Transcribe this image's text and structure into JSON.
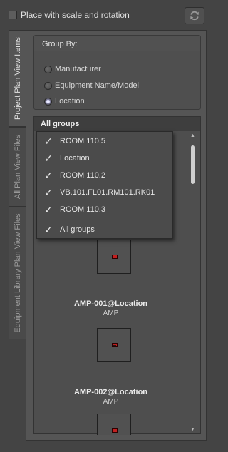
{
  "top": {
    "place_label": "Place with scale and rotation",
    "place_checked": false
  },
  "tabs": [
    {
      "label": "Project Plan View Items",
      "active": true
    },
    {
      "label": "All Plan View Files",
      "active": false
    },
    {
      "label": "Equipment Library Plan View Files",
      "active": false
    }
  ],
  "group_by": {
    "title": "Group By:",
    "options": [
      {
        "label": "Manufacturer",
        "selected": false
      },
      {
        "label": "Equipment Name/Model",
        "selected": false
      },
      {
        "label": "Location",
        "selected": true
      }
    ]
  },
  "list": {
    "header": "All groups",
    "items": [
      {
        "name": "AMP-001@Location",
        "type": "AMP"
      },
      {
        "name": "AMP-002@Location",
        "type": "AMP"
      },
      {
        "name": "",
        "type": ""
      }
    ]
  },
  "dropdown": {
    "items": [
      {
        "label": "ROOM 110.5",
        "checked": true
      },
      {
        "label": "Location",
        "checked": true
      },
      {
        "label": "ROOM 110.2",
        "checked": true
      },
      {
        "label": "VB.101.FL01.RM101.RK01",
        "checked": true
      },
      {
        "label": "ROOM 110.3",
        "checked": true
      },
      {
        "label": "All groups",
        "checked": true
      }
    ]
  },
  "icons": {
    "refresh": "refresh-icon",
    "check": "checkmark-icon",
    "scroll_up": "scroll-up-arrow-icon",
    "scroll_down": "scroll-down-arrow-icon",
    "equipment": "amp-equipment-icon"
  },
  "colors": {
    "background": "#444444",
    "panel": "#555555",
    "header": "#3e3e3e",
    "equipment_red": "#c21f1f"
  }
}
